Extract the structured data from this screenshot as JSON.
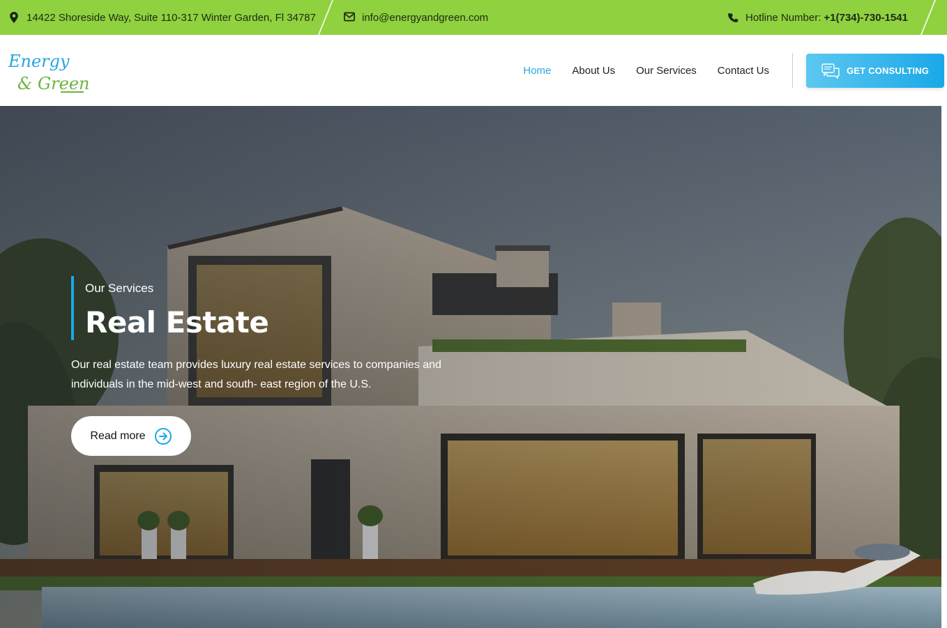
{
  "topbar": {
    "address": "14422 Shoreside Way, Suite 110-317 Winter Garden, Fl 34787",
    "email": "info@energyandgreen.com",
    "hotline_label": "Hotline Number:",
    "hotline_number": "+1(734)-730-1541",
    "icons": [
      "map-pin-icon",
      "envelope-icon",
      "phone-icon"
    ],
    "background_color": "#8fd13f"
  },
  "header": {
    "logo_line1": "Energy",
    "logo_line2": "& Green",
    "nav": [
      {
        "label": "Home",
        "active": true
      },
      {
        "label": "About Us",
        "active": false
      },
      {
        "label": "Our Services",
        "active": false
      },
      {
        "label": "Contact Us",
        "active": false
      }
    ],
    "cta_label": "GET CONSULTING",
    "cta_icon": "chat-bubbles-icon",
    "accent_color": "#1aa8e8"
  },
  "hero": {
    "eyebrow": "Our Services",
    "title": "Real Estate",
    "description": "Our real estate team provides luxury real estate services to companies and individuals in the mid-west and south- east region of the U.S.",
    "button_label": "Read more",
    "button_icon": "arrow-right-circle-icon"
  }
}
